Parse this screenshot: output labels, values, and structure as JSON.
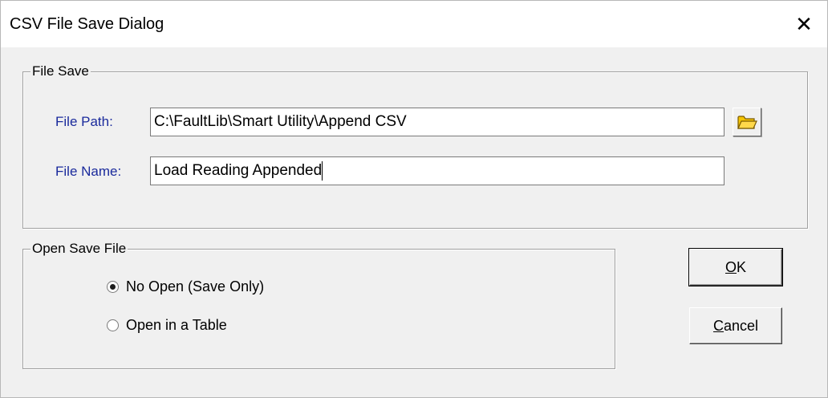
{
  "window": {
    "title": "CSV File Save Dialog",
    "close_glyph": "✕"
  },
  "file_save": {
    "legend": "File Save",
    "path_label": "File Path:",
    "path_value": "C:\\FaultLib\\Smart Utility\\Append CSV",
    "name_label": "File Name:",
    "name_value": "Load Reading Appended",
    "browse_icon": "folder-icon"
  },
  "open_save": {
    "legend": "Open Save File",
    "options": [
      {
        "label": "No Open (Save Only)",
        "selected": true
      },
      {
        "label": "Open in a Table",
        "selected": false
      }
    ]
  },
  "buttons": {
    "ok_accel": "O",
    "ok_rest": "K",
    "cancel_accel": "C",
    "cancel_rest": "ancel"
  },
  "colors": {
    "label_blue": "#1a2a9c",
    "folder_yellow": "#f5c400",
    "dialog_bg": "#f0f0f0"
  }
}
